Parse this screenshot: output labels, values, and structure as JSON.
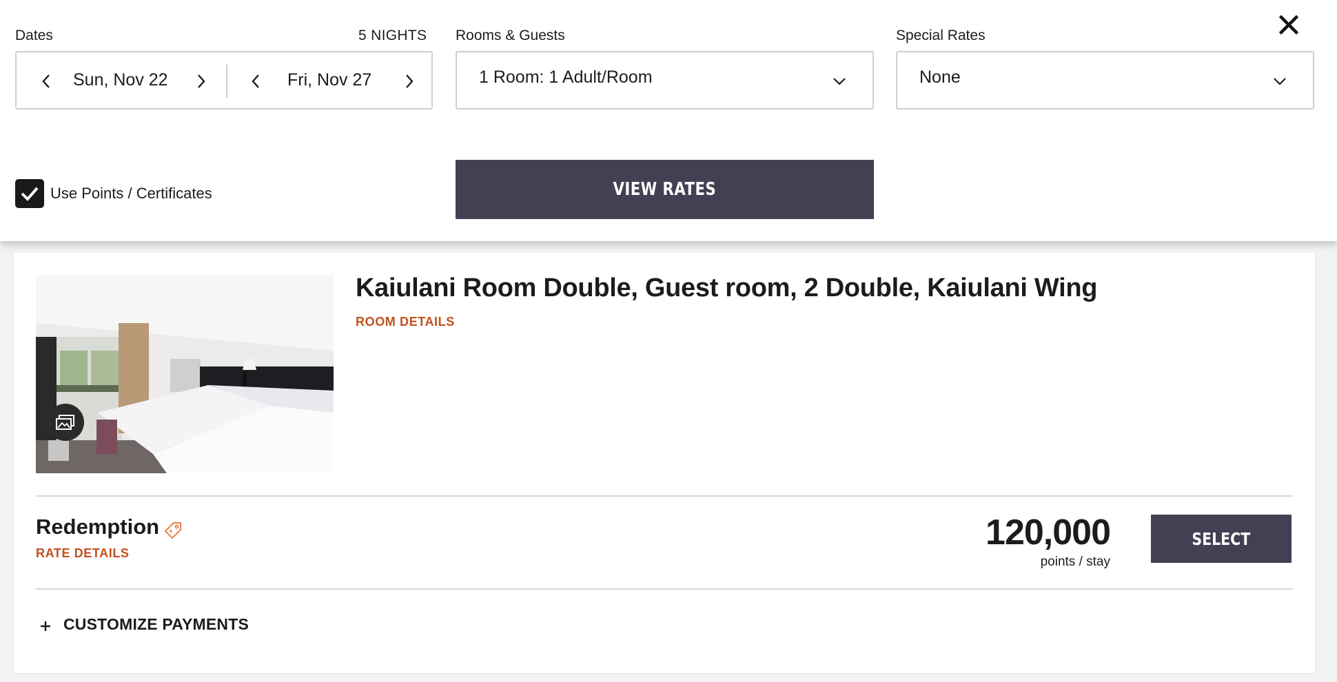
{
  "search": {
    "dates_label": "Dates",
    "nights": "5 NIGHTS",
    "check_in": "Sun, Nov 22",
    "check_out": "Fri, Nov 27",
    "rooms_label": "Rooms & Guests",
    "rooms_value": "1 Room: 1 Adult/Room",
    "special_rates_label": "Special Rates",
    "special_rates_value": "None",
    "use_points_label": "Use Points / Certificates",
    "use_points_checked": true,
    "view_rates_button": "VIEW RATES"
  },
  "room": {
    "title": "Kaiulani Room Double, Guest room, 2 Double, Kaiulani Wing",
    "details_link": "ROOM DETAILS",
    "rate_name": "Redemption",
    "rate_details_link": "RATE DETAILS",
    "points": "120,000",
    "points_unit": "points / stay",
    "select_button": "SELECT",
    "customize_payments": "CUSTOMIZE PAYMENTS"
  },
  "colors": {
    "accent_link": "#c0501e",
    "button_bg": "#424052",
    "tag_icon": "#e8814a"
  },
  "icons": {
    "prev": "chevron-left-icon",
    "next": "chevron-right-icon",
    "dropdown": "chevron-down-icon",
    "close": "close-icon",
    "check": "checkmark-icon",
    "gallery": "photo-gallery-icon",
    "tag": "price-tag-icon",
    "expand": "plus-icon"
  }
}
